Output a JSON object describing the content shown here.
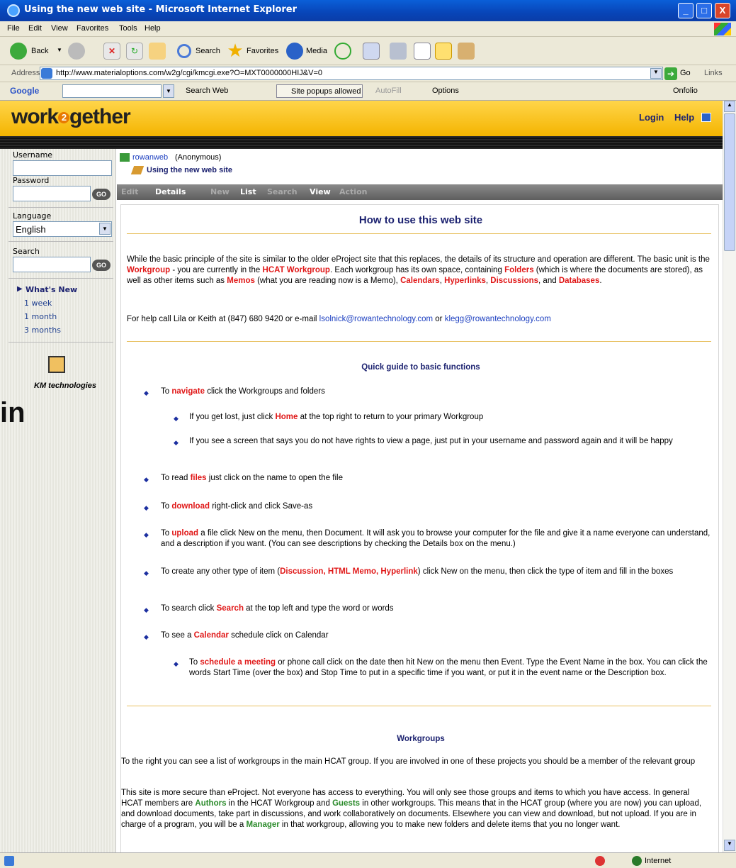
{
  "window": {
    "title": "Using the new web site - Microsoft Internet Explorer",
    "min": "_",
    "max": "□",
    "close": "X"
  },
  "menu": [
    "File",
    "Edit",
    "View",
    "Favorites",
    "Tools",
    "Help"
  ],
  "toolbar": {
    "back": "Back",
    "search": "Search",
    "favorites": "Favorites",
    "media": "Media"
  },
  "address": {
    "label": "Address",
    "url": "http://www.materialoptions.com/w2g/cgi/kmcgi.exe?O=MXT0000000HIJ&V=0",
    "go": "Go",
    "links": "Links"
  },
  "googlebar": {
    "brand": "Google",
    "search_web": "Search Web",
    "popups": "Site popups allowed",
    "autofill": "AutoFill",
    "options": "Options",
    "onfolio": "Onfolio"
  },
  "site": {
    "logo_left": "work",
    "logo_mid": "2",
    "logo_right": "gether",
    "login": "Login",
    "help": "Help"
  },
  "sidebar": {
    "username_label": "Username",
    "password_label": "Password",
    "language_label": "Language",
    "language_value": "English",
    "search_label": "Search",
    "go": "GO",
    "whats_new": "What's New",
    "week": "1 week",
    "month": "1 month",
    "months3": "3 months",
    "km": "KM technologies"
  },
  "overlay_text": "in",
  "crumbs": {
    "user": "rowanweb",
    "anon": "(Anonymous)",
    "page": "Using the new web site"
  },
  "tabs": [
    "Edit",
    "Details",
    "New",
    "List",
    "Search",
    "View",
    "Action"
  ],
  "content": {
    "title": "How to use this web site",
    "intro": [
      {
        "t": "While the basic principle of the site is similar to the older eProject site that this replaces, the details of its structure and operation are different.  The basic unit is the "
      },
      {
        "t": "Workgroup",
        "c": "red"
      },
      {
        "t": " - you are currently in the "
      },
      {
        "t": "HCAT Workgroup",
        "c": "red"
      },
      {
        "t": ".  Each workgroup has its own space, containing "
      },
      {
        "t": "Folders",
        "c": "red"
      },
      {
        "t": " (which is where the documents are stored), as well as other items such as "
      },
      {
        "t": "Memos",
        "c": "red"
      },
      {
        "t": " (what you are reading now is a Memo), "
      },
      {
        "t": "Calendars",
        "c": "red"
      },
      {
        "t": ", "
      },
      {
        "t": "Hyperlinks",
        "c": "red"
      },
      {
        "t": ", "
      },
      {
        "t": "Discussions",
        "c": "red"
      },
      {
        "t": ", and "
      },
      {
        "t": "Databases",
        "c": "red"
      },
      {
        "t": "."
      }
    ],
    "help": [
      {
        "t": "For help call Lila or Keith at (847) 680 9420 or e-mail "
      },
      {
        "t": "lsolnick@rowantechnology.com",
        "c": "lk"
      },
      {
        "t": " or "
      },
      {
        "t": "klegg@rowantechnology.com",
        "c": "lk"
      }
    ],
    "quick_title": "Quick guide to basic functions",
    "b1": [
      {
        "t": "To "
      },
      {
        "t": "navigate",
        "c": "red"
      },
      {
        "t": " click the Workgroups and folders"
      }
    ],
    "b1a": [
      {
        "t": "If you get lost, just click "
      },
      {
        "t": "Home",
        "c": "red"
      },
      {
        "t": " at the top right to return to your primary Workgroup"
      }
    ],
    "b1b": [
      {
        "t": "If you see a screen that says you do not have rights to view a page, just put in your username and password again and it will be happy"
      }
    ],
    "b2": [
      {
        "t": "To read "
      },
      {
        "t": "files",
        "c": "red"
      },
      {
        "t": " just click on the name to open the file"
      }
    ],
    "b3": [
      {
        "t": "To "
      },
      {
        "t": "download",
        "c": "red"
      },
      {
        "t": " right-click and click Save-as"
      }
    ],
    "b4": [
      {
        "t": "To "
      },
      {
        "t": "upload",
        "c": "red"
      },
      {
        "t": " a file click New on the menu, then Document.  It will ask you to browse your computer for the file and give it a name everyone can understand, and a description if you want.  (You can see descriptions by checking the Details box on the menu.)"
      }
    ],
    "b5": [
      {
        "t": "To create any other type of item ("
      },
      {
        "t": "Discussion, HTML Memo, Hyperlink",
        "c": "red"
      },
      {
        "t": ") click New on the menu, then click the type of item and fill in the boxes"
      }
    ],
    "b6": [
      {
        "t": "To search click "
      },
      {
        "t": "Search",
        "c": "red"
      },
      {
        "t": " at the top left and type the word or words"
      }
    ],
    "b7": [
      {
        "t": "To see a "
      },
      {
        "t": "Calendar",
        "c": "red"
      },
      {
        "t": " schedule click on Calendar"
      }
    ],
    "b7a": [
      {
        "t": "To "
      },
      {
        "t": "schedule a meeting",
        "c": "red"
      },
      {
        "t": " or phone call click on the date then hit New on the menu then Event.  Type the Event Name in the box.  You can click the words Start Time (over the box) and Stop Time to put in a specific time if you want, or put it in the event name or the Description box."
      }
    ],
    "wg_title": "Workgroups",
    "wg1": [
      {
        "t": "To the right you can see a list of workgroups in the main HCAT group.  If you are involved in one of these projects you should be a member of the relevant group"
      }
    ],
    "wg2": [
      {
        "t": "This site is more secure than eProject.  Not everyone has access to everything.  You will only see those groups and items to which you have access.  In general HCAT members are "
      },
      {
        "t": "Authors",
        "c": "green"
      },
      {
        "t": " in the HCAT Workgroup and "
      },
      {
        "t": "Guests",
        "c": "green"
      },
      {
        "t": " in other workgroups.  This means that in the HCAT group (where you are now) you can upload, and download documents, take part in discussions, and work collaboratively on documents.  Elsewhere you can view and download, but not upload.  If you are in charge of a program, you will be a "
      },
      {
        "t": "Manager",
        "c": "green"
      },
      {
        "t": " in that workgroup, allowing you to make new folders and delete items that you no longer want."
      }
    ]
  },
  "status": {
    "zone": "Internet"
  },
  "colors": {
    "titlebar": "#0845b8",
    "siteheader": "#f4b400",
    "red": "#e01818",
    "navy": "#1c2270"
  }
}
